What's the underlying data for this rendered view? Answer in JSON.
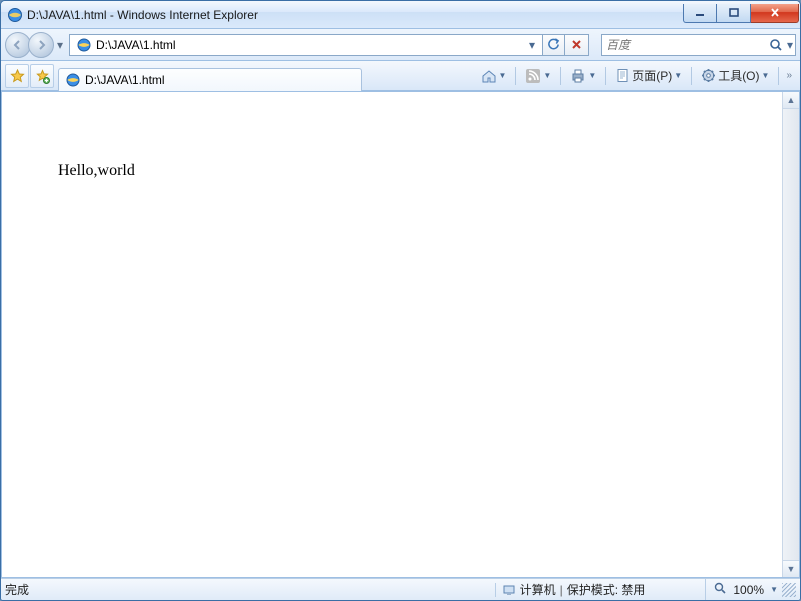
{
  "window": {
    "title": "D:\\JAVA\\1.html - Windows Internet Explorer"
  },
  "address": {
    "url": "D:\\JAVA\\1.html"
  },
  "search": {
    "placeholder": "百度"
  },
  "tab": {
    "title": "D:\\JAVA\\1.html"
  },
  "toolbar": {
    "page_label": "页面(P)",
    "tools_label": "工具(O)"
  },
  "page": {
    "body_text": "Hello,world"
  },
  "status": {
    "done": "完成",
    "zone": "计算机",
    "protected": "保护模式: 禁用",
    "zoom": "100%"
  }
}
